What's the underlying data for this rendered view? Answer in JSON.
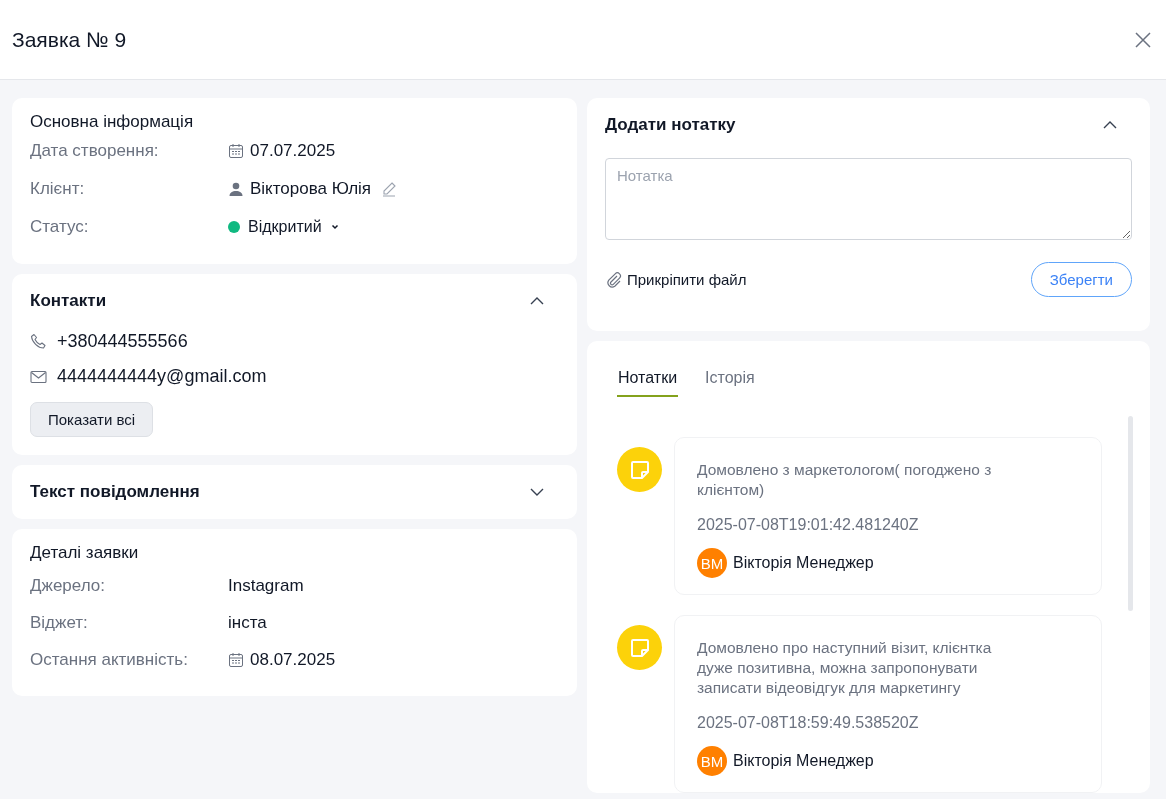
{
  "title": "Заявка № 9",
  "basic_info": {
    "title": "Основна інформація",
    "fields": [
      {
        "kind": "date",
        "label": "Дата створення:",
        "value": "07.07.2025"
      },
      {
        "kind": "client",
        "label": "Клієнт:",
        "value": "Вікторова Юлія"
      },
      {
        "kind": "status",
        "label": "Статус:",
        "value": "Відкритий",
        "color": "#10b981"
      }
    ]
  },
  "contacts": {
    "title": "Контакти",
    "expanded": true,
    "items": [
      {
        "kind": "phone",
        "value": "+380444555566"
      },
      {
        "kind": "email",
        "value": "4444444444y@gmail.com"
      }
    ],
    "show_all_button": "Показати всі"
  },
  "message_text": {
    "title": "Текст повідомлення",
    "expanded": false
  },
  "details": {
    "title": "Деталі заявки",
    "fields": [
      {
        "kind": "text",
        "label": "Джерело:",
        "value": "Instagram"
      },
      {
        "kind": "text",
        "label": "Віджет:",
        "value": "інста"
      },
      {
        "kind": "date",
        "label": "Остання активність:",
        "value": "08.07.2025"
      }
    ]
  },
  "add_note": {
    "title": "Додати нотатку",
    "expanded": true,
    "placeholder": "Нотатка",
    "attach_label": "Прикріпити файл",
    "save_button": "Зберегти"
  },
  "notes_panel": {
    "tabs": [
      {
        "label": "Нотатки",
        "selected": true
      },
      {
        "label": "Історія",
        "selected": false
      }
    ],
    "notes": [
      {
        "text": "Домовлено з маркетологом( погоджено з клієнтом)",
        "timestamp": "2025-07-08T19:01:42.481240Z",
        "author_initials": "ВМ",
        "author": "Вікторія Менеджер"
      },
      {
        "text": "Домовлено про наступний візит, клієнтка дуже позитивна, можна запропонувати записати відеовідгук для маркетингу",
        "timestamp": "2025-07-08T18:59:49.538520Z",
        "author_initials": "ВМ",
        "author": "Вікторія Менеджер"
      }
    ]
  }
}
